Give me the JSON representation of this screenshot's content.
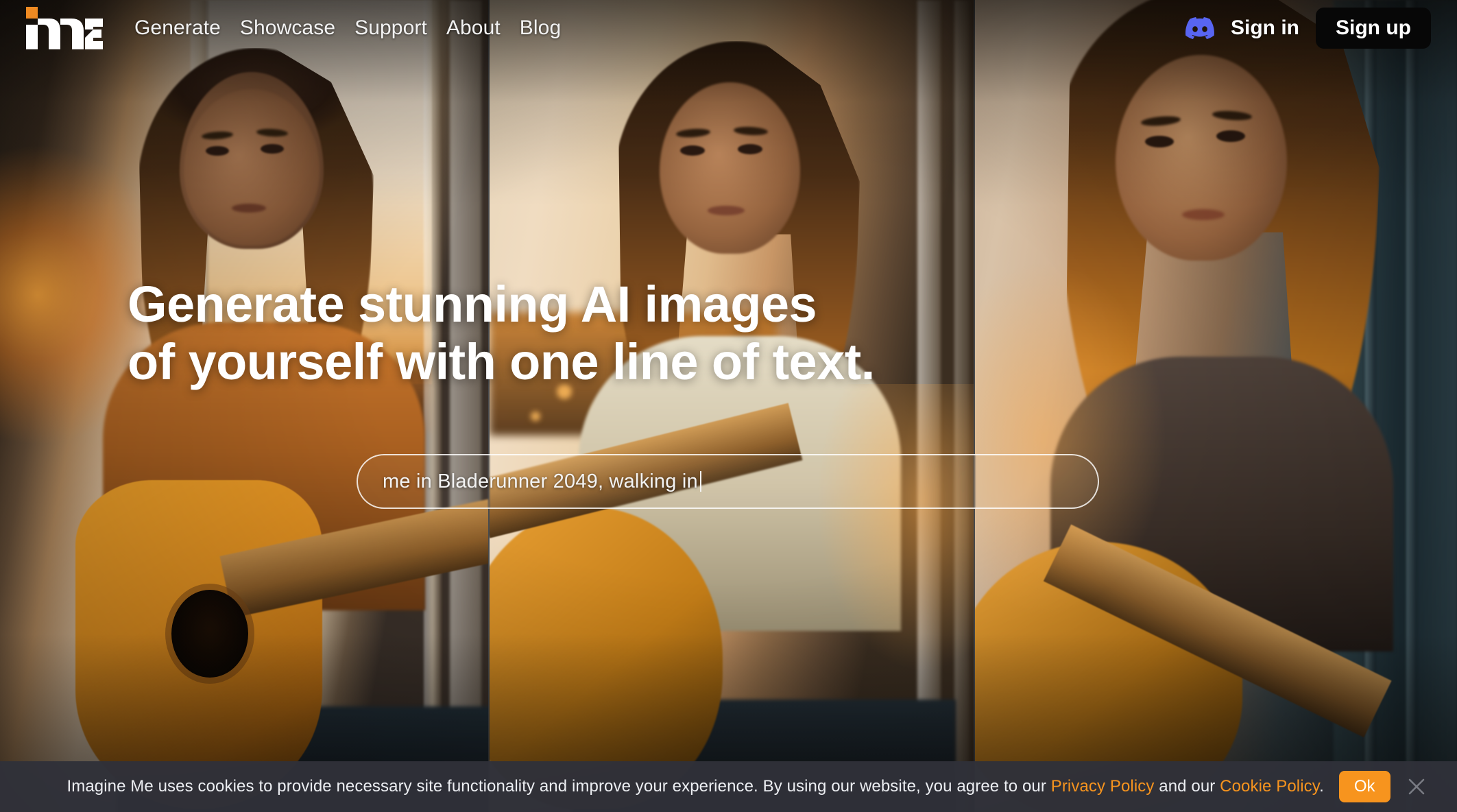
{
  "brand": {
    "name": "Imagine Me",
    "logo_icon": "imagine-me-logo",
    "accent_color": "#f7941e",
    "logo_dot_color": "#ef8a22"
  },
  "nav": {
    "links": [
      {
        "label": "Generate"
      },
      {
        "label": "Showcase"
      },
      {
        "label": "Support"
      },
      {
        "label": "About"
      },
      {
        "label": "Blog"
      }
    ],
    "discord_icon": "discord-icon",
    "sign_in_label": "Sign in",
    "sign_up_label": "Sign up",
    "sign_up_bg": "#070707"
  },
  "hero": {
    "headline_line1": "Generate stunning AI images",
    "headline_line2": "of yourself with one line of text.",
    "prompt": {
      "value": "me in Bladerunner 2049, walking in",
      "placeholder": "me in Bladerunner 2049, walking in"
    },
    "image_alt": "Young woman playing an acoustic guitar by a window at golden-hour sunset, shown as three panels"
  },
  "cookie_banner": {
    "text_before_privacy": "Imagine Me uses cookies to provide necessary site functionality and improve your experience. By using our website, you agree to our ",
    "privacy_link": "Privacy Policy",
    "text_middle": " and our ",
    "cookie_link": "Cookie Policy",
    "text_after": ".",
    "ok_label": "Ok",
    "ok_color": "#f7941e",
    "close_icon": "close-icon",
    "background": "#303139"
  }
}
